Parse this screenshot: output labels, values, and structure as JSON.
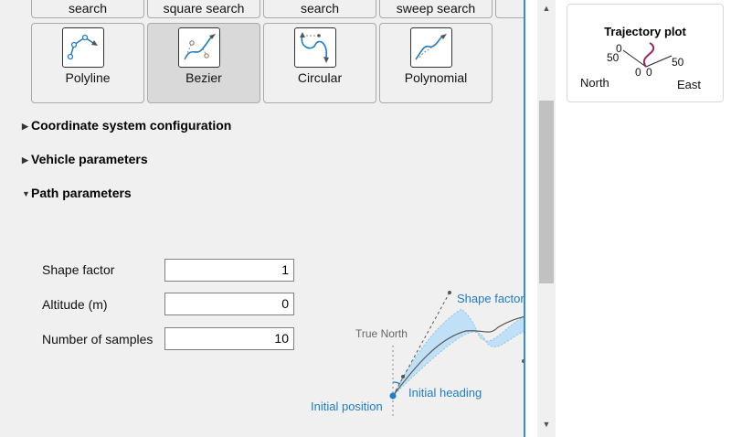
{
  "top_row_labels": [
    "search",
    "square search",
    "search",
    "sweep search"
  ],
  "path_types": [
    {
      "label": "Polyline",
      "selected": false,
      "icon": "polyline-icon"
    },
    {
      "label": "Bezier",
      "selected": true,
      "icon": "bezier-icon"
    },
    {
      "label": "Circular",
      "selected": false,
      "icon": "circular-icon"
    },
    {
      "label": "Polynomial",
      "selected": false,
      "icon": "polynomial-icon"
    }
  ],
  "sections": {
    "coordinate": {
      "label": "Coordinate system configuration",
      "expanded": false
    },
    "vehicle": {
      "label": "Vehicle parameters",
      "expanded": false
    },
    "path": {
      "label": "Path parameters",
      "expanded": true
    }
  },
  "fields": {
    "shape_factor": {
      "label": "Shape factor",
      "value": "1"
    },
    "altitude": {
      "label": "Altitude (m)",
      "value": "0"
    },
    "samples": {
      "label": "Number of samples",
      "value": "10"
    }
  },
  "diagram": {
    "shape_factor": "Shape factor",
    "true_north": "True North",
    "initial_heading": "Initial heading",
    "initial_position": "Initial position"
  },
  "trajectory": {
    "title": "Trajectory plot",
    "north_label": "North",
    "east_label": "East",
    "ticks": {
      "left_50": "50",
      "left_0": "0",
      "right_50": "50",
      "bottom_0a": "0",
      "bottom_0b": "0"
    }
  },
  "colors": {
    "accent": "#1f7cc6",
    "divider": "#3a8ad8",
    "trajectory": "#a0235f",
    "selected_tile": "#d9d9d9"
  }
}
